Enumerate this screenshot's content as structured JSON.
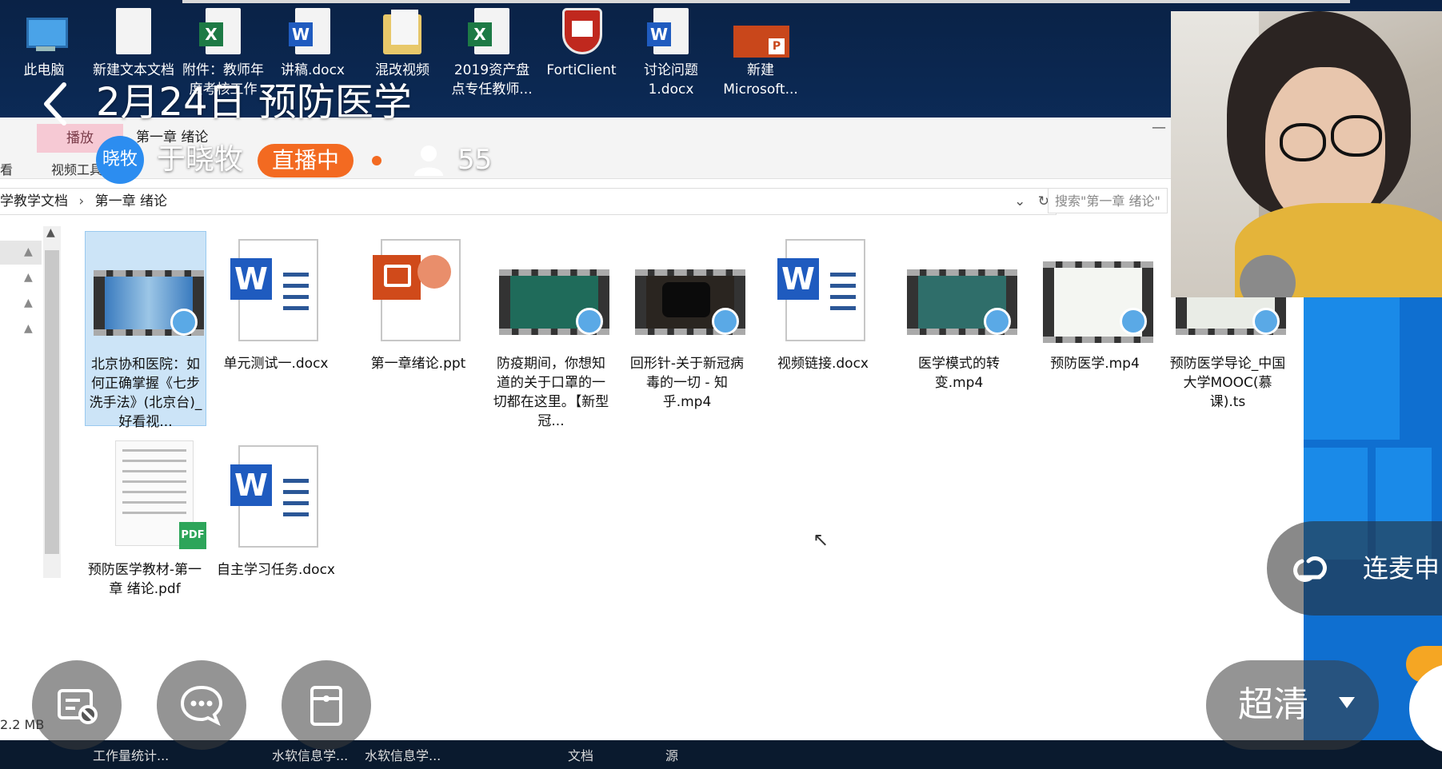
{
  "desktop": {
    "icons": [
      {
        "label": "此电脑",
        "icon": "computer-icon"
      },
      {
        "label": "新建文本文档",
        "icon": "text-file-icon"
      },
      {
        "label": "附件：教师年度考核工作",
        "icon": "excel-icon"
      },
      {
        "label": "讲稿.docx",
        "icon": "word-icon"
      },
      {
        "label": "混改视频",
        "icon": "folder-icon"
      },
      {
        "label": "2019资产盘点专任教师...",
        "icon": "excel-icon"
      },
      {
        "label": "FortiClient",
        "icon": "forticlient-icon"
      },
      {
        "label": "讨论问题1.docx",
        "icon": "word-icon"
      },
      {
        "label": "新建Microsoft...",
        "icon": "powerpoint-icon"
      }
    ]
  },
  "explorer": {
    "ribbon": {
      "play_tab": "播放",
      "window_title": "第一章 绪论",
      "view_tab": "看",
      "video_tools_tab": "视频工具"
    },
    "breadcrumb": [
      "学教学文档",
      "第一章 绪论"
    ],
    "search_placeholder": "搜索\"第一章 绪论\"",
    "size_info": "2.2 MB",
    "files": [
      {
        "name": "北京协和医院：如何正确掌握《七步洗手法》(北京台)_好看视...",
        "type": "video",
        "selected": true
      },
      {
        "name": "单元测试一.docx",
        "type": "word"
      },
      {
        "name": "第一章绪论.ppt",
        "type": "ppt"
      },
      {
        "name": "防疫期间，你想知道的关于口罩的一切都在这里。【新型冠...",
        "type": "video"
      },
      {
        "name": "回形针-关于新冠病毒的一切 - 知乎.mp4",
        "type": "video"
      },
      {
        "name": "视频链接.docx",
        "type": "word"
      },
      {
        "name": "医学模式的转变.mp4",
        "type": "video"
      },
      {
        "name": "预防医学.mp4",
        "type": "video"
      },
      {
        "name": "预防医学导论_中国大学MOOC(慕课).ts",
        "type": "video"
      },
      {
        "name": "预防医学教材-第一章 绪论.pdf",
        "type": "pdf"
      },
      {
        "name": "自主学习任务.docx",
        "type": "word"
      }
    ]
  },
  "taskbar": {
    "items": [
      "工作量统计...",
      "水软信息学...",
      "水软信息学...",
      "文档",
      "源"
    ]
  },
  "live": {
    "title": "2月24日 预防医学",
    "host_avatar_text": "晓牧",
    "host_name": "于晓牧",
    "status_badge": "直播中",
    "viewer_count": "55",
    "mic_link_label": "连麦申",
    "quality_label": "超清",
    "controls": [
      "screen-share-icon",
      "chat-icon",
      "clipboard-icon"
    ]
  },
  "colors": {
    "live_badge": "#f36a21",
    "avatar": "#2c8df0",
    "selection": "#cce4f7"
  }
}
